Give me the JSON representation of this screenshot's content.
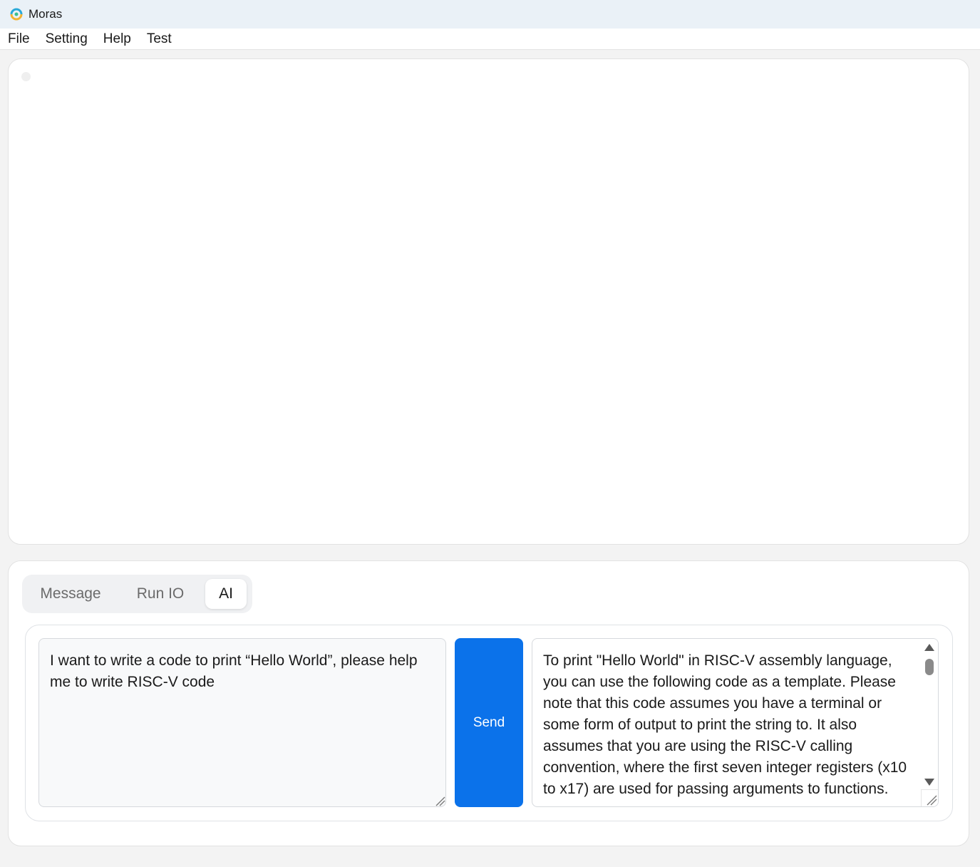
{
  "window": {
    "title": "Moras",
    "icon": "moras-logo-icon"
  },
  "menu": {
    "items": [
      {
        "label": "File"
      },
      {
        "label": "Setting"
      },
      {
        "label": "Help"
      },
      {
        "label": "Test"
      }
    ]
  },
  "bottom": {
    "tabs": [
      {
        "label": "Message",
        "active": false
      },
      {
        "label": "Run IO",
        "active": false
      },
      {
        "label": "AI",
        "active": true
      }
    ],
    "ai": {
      "prompt": "I want to write a code to print “Hello World”, please help me to write RISC-V code",
      "send_label": "Send",
      "response": "To print \"Hello World\" in RISC-V assembly language, you can use the following code as a template. Please note that this code assumes you have a terminal or some form of output to print the string to. It also assumes that you are using the RISC-V calling convention, where the first seven integer registers (x10 to x17) are used for passing arguments to functions."
    }
  },
  "colors": {
    "accent": "#0b72ea",
    "titlebar": "#eaf1f7"
  }
}
